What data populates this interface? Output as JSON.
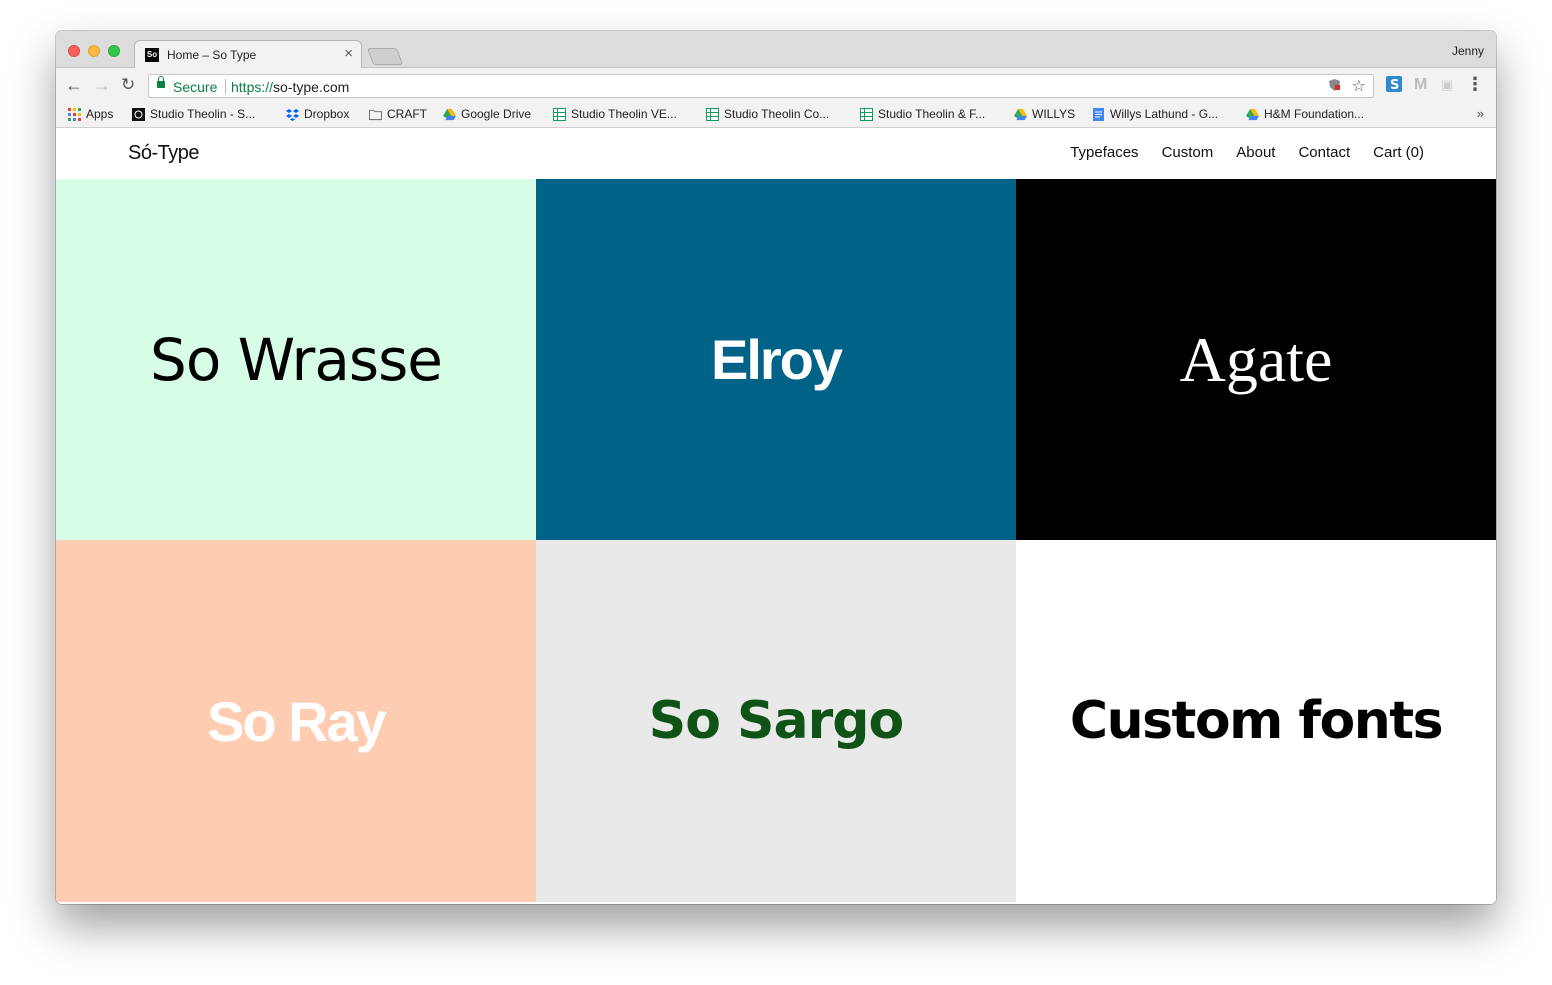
{
  "browser": {
    "tab_title": "Home – So Type",
    "tab_favicon": "So",
    "profile_name": "Jenny",
    "secure_label": "Secure",
    "url_scheme": "https://",
    "url_host": "so-type.com"
  },
  "bookmarks": [
    {
      "label": "Apps",
      "icon": "apps-grid-icon"
    },
    {
      "label": "Studio Theolin - S...",
      "icon": "studio-theolin-icon"
    },
    {
      "label": "Dropbox",
      "icon": "dropbox-icon"
    },
    {
      "label": "CRAFT",
      "icon": "folder-icon"
    },
    {
      "label": "Google Drive",
      "icon": "google-drive-icon"
    },
    {
      "label": "Studio Theolin VE...",
      "icon": "sheets-icon"
    },
    {
      "label": "Studio Theolin Co...",
      "icon": "sheets-icon"
    },
    {
      "label": "Studio Theolin & F...",
      "icon": "sheets-icon"
    },
    {
      "label": "WILLYS",
      "icon": "google-drive-icon"
    },
    {
      "label": "Willys Lathund - G...",
      "icon": "docs-icon"
    },
    {
      "label": "H&M Foundation...",
      "icon": "google-drive-icon"
    }
  ],
  "site": {
    "logo": "Só-Type",
    "nav": [
      "Typefaces",
      "Custom",
      "About",
      "Contact",
      "Cart (0)"
    ]
  },
  "tiles": [
    {
      "label": "So Wrasse",
      "bg": "#d7fde6",
      "color": "#000000"
    },
    {
      "label": "Elroy",
      "bg": "#006286",
      "color": "#ffffff"
    },
    {
      "label": "Agate",
      "bg": "#000000",
      "color": "#ffffff"
    },
    {
      "label": "So Ray",
      "bg": "#fecdb1",
      "color": "#ffffff"
    },
    {
      "label": "So Sargo",
      "bg": "#e9e9e9",
      "color": "#0f5416"
    },
    {
      "label": "Custom fonts",
      "bg": "#ffffff",
      "color": "#000000"
    }
  ]
}
